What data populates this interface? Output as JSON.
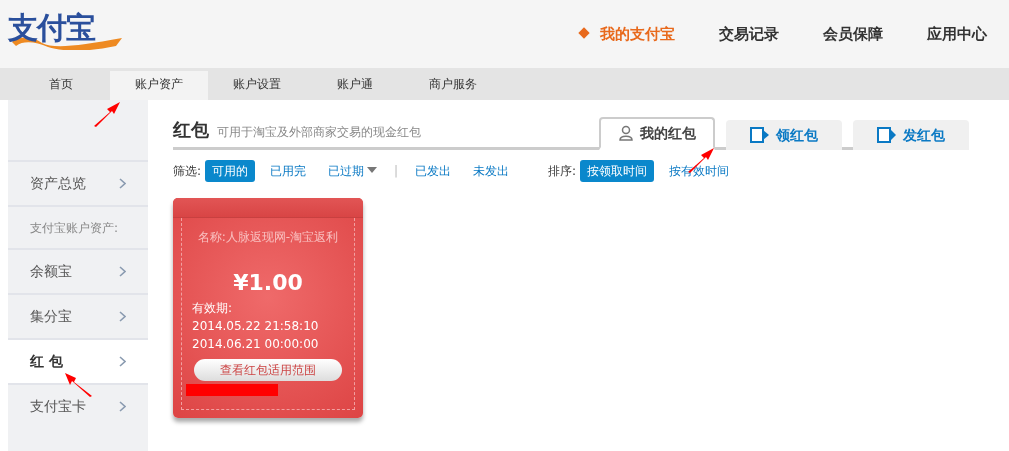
{
  "logo": {
    "text": "支付宝"
  },
  "main_nav": [
    {
      "label": "我的支付宝",
      "selected": true
    },
    {
      "label": "交易记录",
      "selected": false
    },
    {
      "label": "会员保障",
      "selected": false
    },
    {
      "label": "应用中心",
      "selected": false
    }
  ],
  "sub_nav": [
    {
      "label": "首页",
      "selected": false
    },
    {
      "label": "账户资产",
      "selected": true
    },
    {
      "label": "账户设置",
      "selected": false
    },
    {
      "label": "账户通",
      "selected": false
    },
    {
      "label": "商户服务",
      "selected": false
    }
  ],
  "sidebar": {
    "items": [
      {
        "kind": "link",
        "label": "资产总览",
        "selected": false
      },
      {
        "kind": "heading",
        "label": "支付宝账户资产:"
      },
      {
        "kind": "link",
        "label": "余额宝",
        "selected": false
      },
      {
        "kind": "link",
        "label": "集分宝",
        "selected": false
      },
      {
        "kind": "link",
        "label": "红 包",
        "selected": true
      },
      {
        "kind": "link",
        "label": "支付宝卡",
        "selected": false
      }
    ]
  },
  "page": {
    "title": "红包",
    "subtitle": "可用于淘宝及外部商家交易的现金红包"
  },
  "tabs": [
    {
      "label": "我的红包",
      "selected": true
    },
    {
      "label": "领红包",
      "selected": false
    },
    {
      "label": "发红包",
      "selected": false
    }
  ],
  "filter": {
    "label": "筛选:",
    "options": [
      {
        "kind": "option",
        "label": "可用的",
        "selected": true,
        "dropdown": false
      },
      {
        "kind": "option",
        "label": "已用完",
        "selected": false,
        "dropdown": false
      },
      {
        "kind": "option",
        "label": "已过期",
        "selected": false,
        "dropdown": true
      },
      {
        "kind": "separator",
        "label": "|"
      },
      {
        "kind": "option",
        "label": "已发出",
        "selected": false,
        "dropdown": false
      },
      {
        "kind": "option",
        "label": "未发出",
        "selected": false,
        "dropdown": false
      }
    ]
  },
  "sort": {
    "label": "排序:",
    "options": [
      {
        "label": "按领取时间",
        "selected": true
      },
      {
        "label": "按有效时间",
        "selected": false
      }
    ]
  },
  "envelopes": [
    {
      "name": "名称:人脉返现网-淘宝返利",
      "amount": "¥1.00",
      "validity_label": "有效期:",
      "start": "2014.05.22 21:58:10",
      "end": "2014.06.21 00:00:00",
      "button": "查看红包适用范围",
      "redacted": true
    }
  ],
  "annotations": [
    {
      "kind": "arrow"
    },
    {
      "kind": "arrow"
    },
    {
      "kind": "arrow"
    }
  ]
}
